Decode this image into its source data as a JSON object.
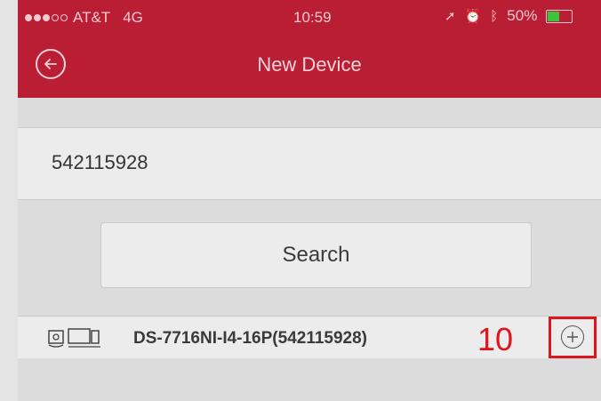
{
  "status_bar": {
    "carrier": "AT&T",
    "network": "4G",
    "time": "10:59",
    "battery": "50%",
    "battery_level": 0.5,
    "icons": [
      "location-arrow-icon",
      "alarm-icon",
      "bluetooth-icon"
    ]
  },
  "nav": {
    "title": "New Device",
    "back_icon": "back-arrow-icon"
  },
  "search": {
    "value": "542115928",
    "button_label": "Search"
  },
  "device": {
    "name": "DS-7716NI-I4-16P(542115928)",
    "icon": "nvr-camera-icon",
    "add_icon": "add-circle-icon"
  },
  "annotation": {
    "step_number": "10",
    "color": "#e0141c"
  },
  "colors": {
    "header": "#ba1e35",
    "battery_fill": "#3ec33e"
  }
}
